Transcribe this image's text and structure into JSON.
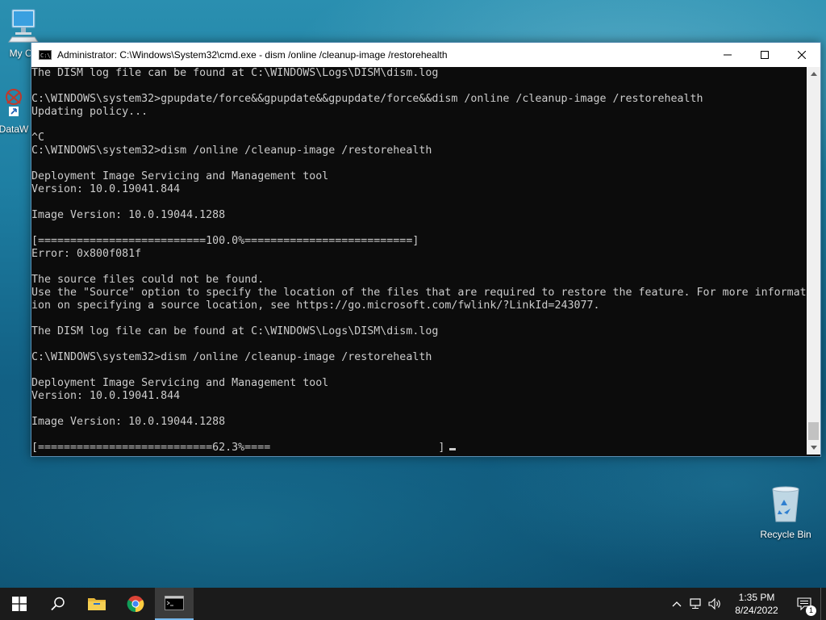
{
  "desktop": {
    "icons": {
      "my_computer": "My Co",
      "dataw": "DataW",
      "recycle_bin": "Recycle Bin"
    }
  },
  "cmd_window": {
    "title": "Administrator: C:\\Windows\\System32\\cmd.exe - dism  /online /cleanup-image /restorehealth",
    "lines": [
      "The DISM log file can be found at C:\\WINDOWS\\Logs\\DISM\\dism.log",
      "",
      "C:\\WINDOWS\\system32>gpupdate/force&&gpupdate&&gpupdate/force&&dism /online /cleanup-image /restorehealth",
      "Updating policy...",
      "",
      "^C",
      "C:\\WINDOWS\\system32>dism /online /cleanup-image /restorehealth",
      "",
      "Deployment Image Servicing and Management tool",
      "Version: 10.0.19041.844",
      "",
      "Image Version: 10.0.19044.1288",
      "",
      "[==========================100.0%==========================]",
      "Error: 0x800f081f",
      "",
      "The source files could not be found.",
      "Use the \"Source\" option to specify the location of the files that are required to restore the feature. For more informat",
      "ion on specifying a source location, see https://go.microsoft.com/fwlink/?LinkId=243077.",
      "",
      "The DISM log file can be found at C:\\WINDOWS\\Logs\\DISM\\dism.log",
      "",
      "C:\\WINDOWS\\system32>dism /online /cleanup-image /restorehealth",
      "",
      "Deployment Image Servicing and Management tool",
      "Version: 10.0.19041.844",
      "",
      "Image Version: 10.0.19044.1288",
      "",
      "[===========================62.3%====                          ]"
    ],
    "progress_percent": 62.3
  },
  "taskbar": {
    "time": "1:35 PM",
    "date": "8/24/2022",
    "notification_count": "1",
    "pinned": [
      "start-icon",
      "search-icon",
      "file-explorer-icon",
      "chrome-icon",
      "cmd-icon"
    ]
  },
  "colors": {
    "console_bg": "#0c0c0c",
    "console_fg": "#cccccc",
    "taskbar_bg": "#1b1b1b",
    "accent": "#76b9ed"
  }
}
